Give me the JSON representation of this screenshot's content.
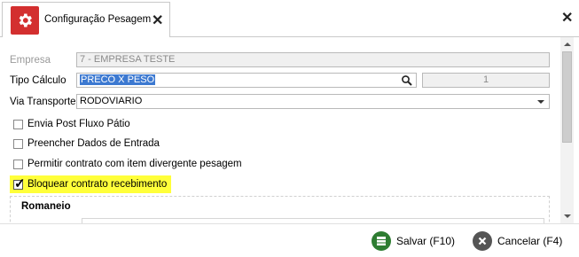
{
  "tab": {
    "title": "Configuração Pesagem",
    "icon": "gear-icon",
    "close": "✕"
  },
  "window": {
    "close": "✕"
  },
  "form": {
    "empresa": {
      "label": "Empresa",
      "value": "7 - EMPRESA TESTE"
    },
    "tipo_calculo": {
      "label": "Tipo Cálculo",
      "value": "PRECO X PESO",
      "number": "1"
    },
    "via_transporte": {
      "label": "Via Transporte",
      "value": "RODOVIARIO"
    },
    "checkboxes": [
      {
        "label": "Envia Post Fluxo Pátio",
        "checked": false
      },
      {
        "label": "Preencher Dados de Entrada",
        "checked": false
      },
      {
        "label": "Permitir contrato com item divergente pesagem",
        "checked": false
      },
      {
        "label": "Bloquear contrato recebimento",
        "checked": true
      }
    ],
    "group_title": "Romaneio"
  },
  "footer": {
    "save_label": "Salvar (F10)",
    "cancel_label": "Cancelar (F4)"
  },
  "colors": {
    "accent": "#d32f2f",
    "highlight": "#ffff3a",
    "selection": "#3c79d1",
    "save": "#2e7d32",
    "cancel": "#555555"
  }
}
